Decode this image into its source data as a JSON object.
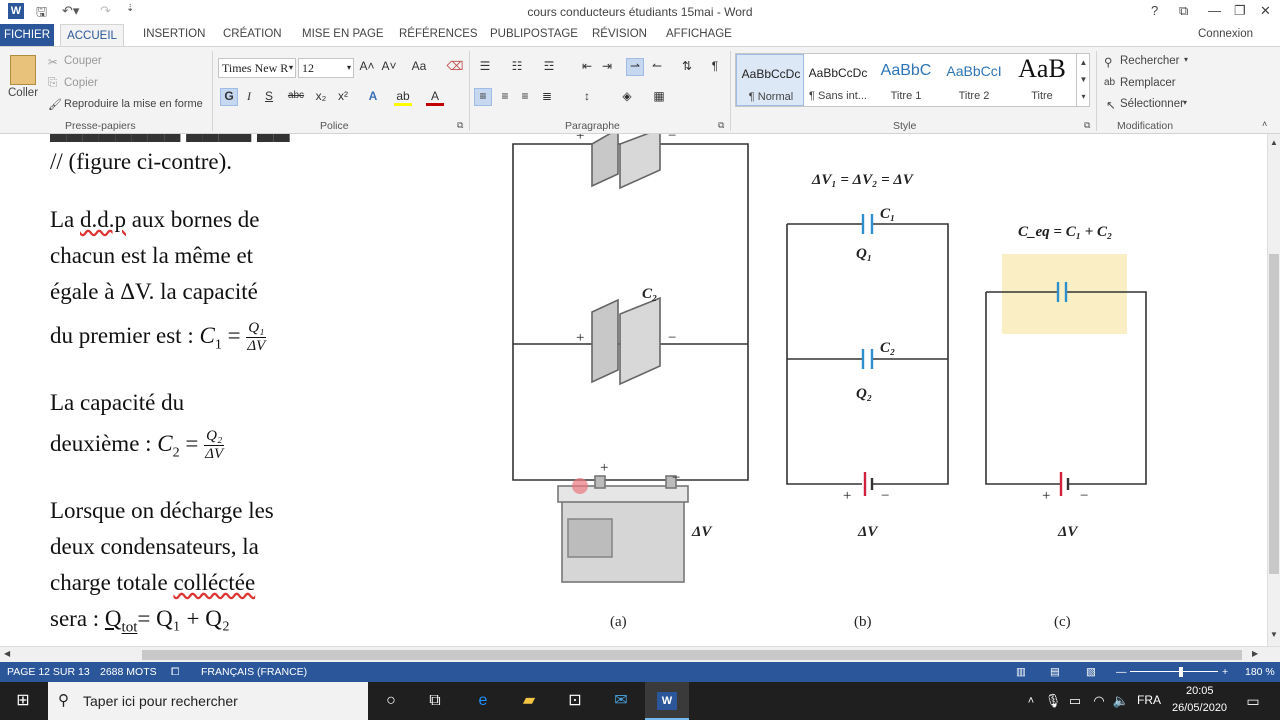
{
  "window": {
    "title": "cours conducteurs étudiants 15mai - Word",
    "signin": "Connexion"
  },
  "tabs": [
    "FICHIER",
    "ACCUEIL",
    "INSERTION",
    "CRÉATION",
    "MISE EN PAGE",
    "RÉFÉRENCES",
    "PUBLIPOSTAGE",
    "RÉVISION",
    "AFFICHAGE"
  ],
  "ribbon": {
    "clipboard": {
      "paste": "Coller",
      "cut": "Couper",
      "copy": "Copier",
      "format_painter": "Reproduire la mise en forme",
      "label": "Presse-papiers"
    },
    "font": {
      "family": "Times New R",
      "size": "12",
      "label": "Police",
      "bold": "G",
      "italic": "I",
      "underline": "S",
      "strike": "abc",
      "sub": "x₂",
      "sup": "x²",
      "grow": "A˄",
      "shrink": "A˅",
      "case": "Aa",
      "effects": "A",
      "highlight": "ab",
      "color": "A"
    },
    "paragraph": {
      "label": "Paragraphe",
      "pilcrow": "¶"
    },
    "styles": {
      "label": "Style",
      "items": [
        {
          "sample": "AaBbCcDc",
          "name": "¶ Normal"
        },
        {
          "sample": "AaBbCcDc",
          "name": "¶ Sans int..."
        },
        {
          "sample": "AaBbC",
          "name": "Titre 1"
        },
        {
          "sample": "AaBbCcI",
          "name": "Titre 2"
        },
        {
          "sample": "AaB",
          "name": "Titre"
        }
      ]
    },
    "editing": {
      "label": "Modification",
      "find": "Rechercher",
      "replace": "Remplacer",
      "select": "Sélectionner"
    }
  },
  "document": {
    "line1": "// (figure ci-contre).",
    "para2": [
      "La ",
      "d.d.p",
      " aux bornes de",
      "chacun est la même et",
      "égale à ΔV. la capacité",
      "du premier est : "
    ],
    "c1": {
      "lhs": "C",
      "sub": "1",
      "eq": " = ",
      "num": "Q₁",
      "den": "ΔV"
    },
    "para3": [
      "La capacité du",
      "deuxième : "
    ],
    "c2": {
      "lhs": "C",
      "sub": "2",
      "eq": " = ",
      "num": "Q₂",
      "den": "ΔV"
    },
    "para4": [
      "Lorsque on décharge les",
      "deux condensateurs, la",
      "charge totale ",
      "colléctée",
      "sera : ",
      "Q",
      "tot",
      "= Q₁ + Q₂"
    ]
  },
  "figure": {
    "dv_eq": "ΔV₁ = ΔV₂ = ΔV",
    "ceq": "C_eq = C₁ + C₂",
    "labels": {
      "C1": "C₁",
      "C2": "C₂",
      "Q1": "Q₁",
      "Q2": "Q₂",
      "dv": "ΔV",
      "plus": "+",
      "minus": "−",
      "a": "(a)",
      "b": "(b)",
      "c": "(c)"
    }
  },
  "status": {
    "page": "PAGE 12 SUR 13",
    "words": "2688 MOTS",
    "lang": "FRANÇAIS (FRANCE)",
    "zoom": "180 %"
  },
  "taskbar": {
    "search": "Taper ici pour rechercher",
    "lang": "FRA",
    "time": "20:05",
    "date": "26/05/2020"
  }
}
